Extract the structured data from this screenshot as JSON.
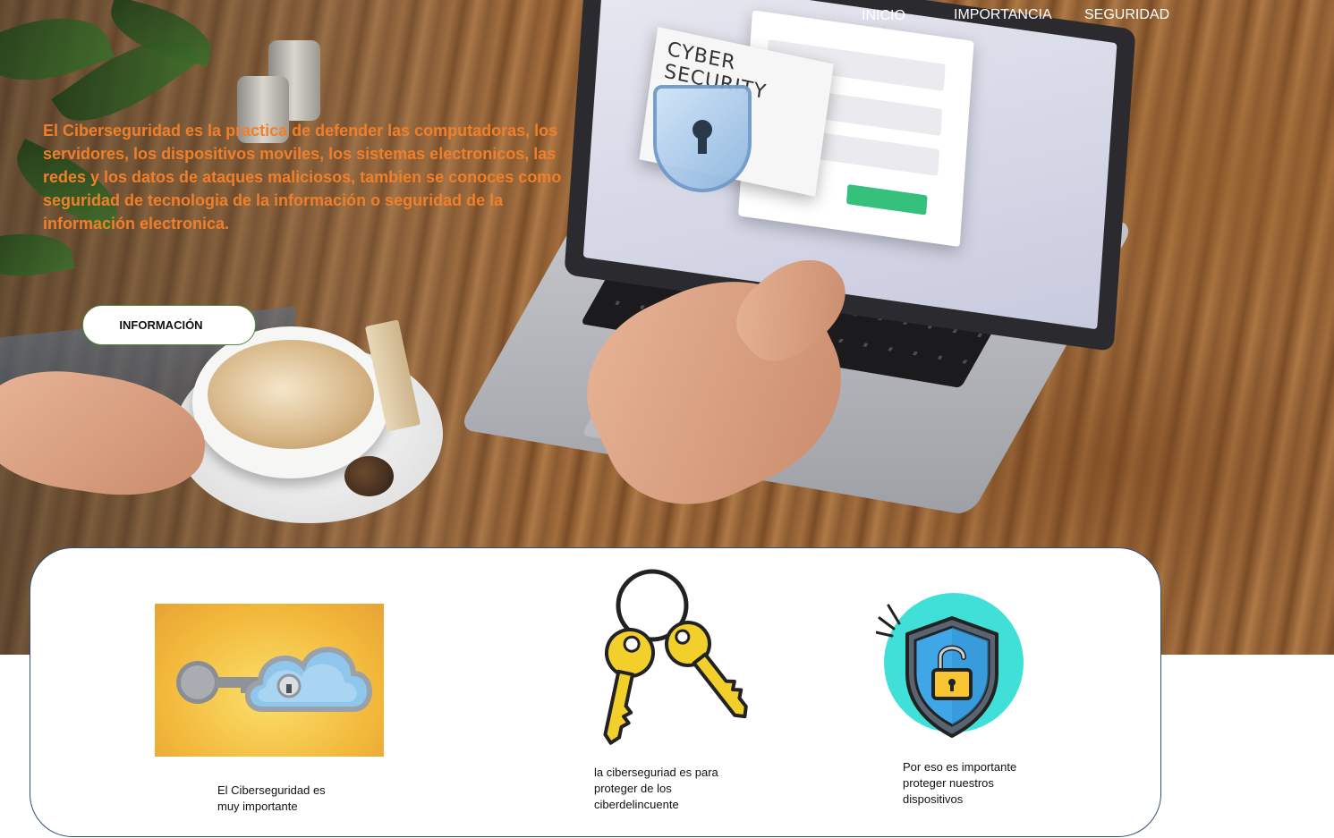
{
  "nav": {
    "items": [
      "INICIO",
      "IMPORTANCIA",
      "SEGURIDAD"
    ]
  },
  "hero": {
    "text": "El Ciberseguridad es la practica de defender las computadoras, los servidores, los dispositivos moviles, los sistemas electronicos, las redes y los datos de ataques maliciosos, tambien se conoces como seguridad de tecnologia de la información  o seguridad de la información electronica.",
    "button_label": "INFORMACIÓN",
    "screen_title": "CYBER SECURITY",
    "text_color": "#f07f2a"
  },
  "features": [
    {
      "icon": "cloud-key-icon",
      "caption": "El Ciberseguridad es muy importante"
    },
    {
      "icon": "keys-icon",
      "caption": "la ciberseguriad es para proteger de los ciberdelincuente"
    },
    {
      "icon": "shield-lock-icon",
      "caption": "Por eso es importante proteger nuestros dispositivos"
    }
  ],
  "colors": {
    "card_border": "#2f4f7a",
    "button_border": "#4e8a3a",
    "key_yellow": "#f2cf2a",
    "shield_circle": "#40e0d8"
  }
}
